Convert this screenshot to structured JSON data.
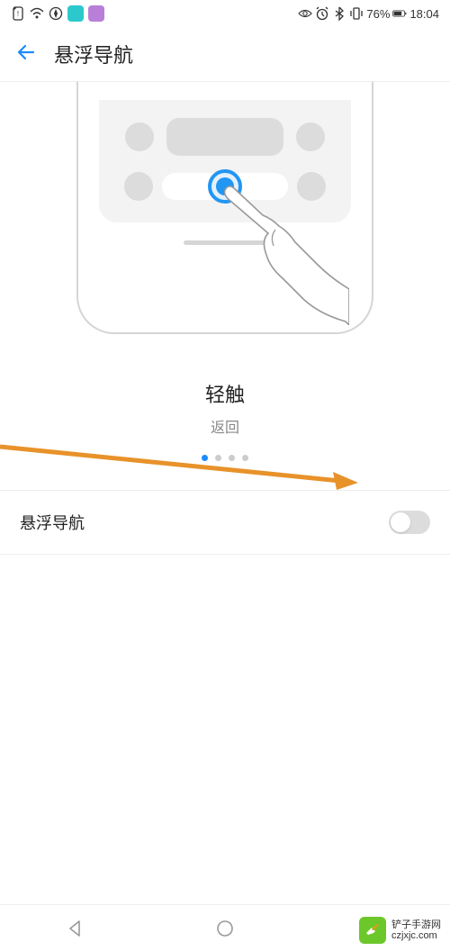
{
  "status_bar": {
    "battery_percent": "76%",
    "time": "18:04"
  },
  "header": {
    "title": "悬浮导航"
  },
  "gesture": {
    "title": "轻触",
    "subtitle": "返回",
    "active_dot": 0,
    "total_dots": 4
  },
  "setting": {
    "label": "悬浮导航",
    "toggle_on": false
  },
  "watermark": {
    "name": "铲子手游网",
    "url": "czjxjc.com"
  }
}
